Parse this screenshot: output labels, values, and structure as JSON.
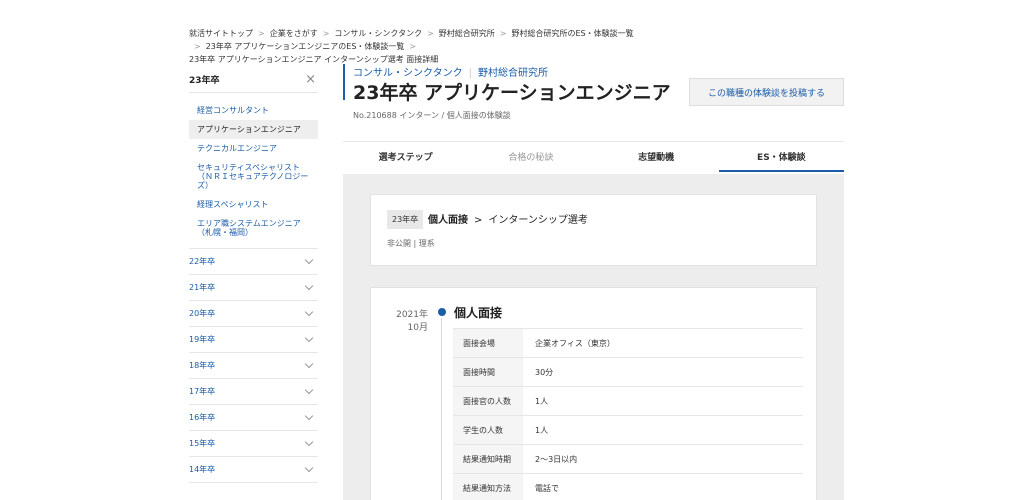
{
  "breadcrumb": [
    "就活サイトトップ",
    "企業をさがす",
    "コンサル・シンクタンク",
    "野村総合研究所",
    "野村総合研究所のES・体験談一覧",
    "23年卒 アプリケーションエンジニアのES・体験談一覧",
    "23年卒 アプリケーションエンジニア インターンシップ選考 面接詳細"
  ],
  "sidebar": {
    "current_year": "23年卒",
    "close_icon": "×",
    "jobs": [
      {
        "label": "経営コンサルタント"
      },
      {
        "label": "アプリケーションエンジニア"
      },
      {
        "label": "テクニカルエンジニア"
      },
      {
        "label": "セキュリティスペシャリスト（ＮＲＩセキュアテクノロジーズ）"
      },
      {
        "label": "経理スペシャリスト"
      },
      {
        "label": "エリア職システムエンジニア（札幌・福岡）"
      }
    ],
    "years": [
      "22年卒",
      "21年卒",
      "20年卒",
      "19年卒",
      "18年卒",
      "17年卒",
      "16年卒",
      "15年卒",
      "14年卒"
    ]
  },
  "header": {
    "category": "コンサル・シンクタンク",
    "company": "野村総合研究所",
    "title": "23年卒 アプリケーションエンジニア",
    "meta": "No.210688 インターン / 個人面接の体験談"
  },
  "post_button": "この職種の体験談を投稿する",
  "tabs": [
    {
      "label": "選考ステップ"
    },
    {
      "label": "合格の秘訣"
    },
    {
      "label": "志望動機"
    },
    {
      "label": "ES・体験談"
    }
  ],
  "summary": {
    "tag": "23年卒",
    "title": "個人面接",
    "arrow": ">",
    "subtitle": "インターンシップ選考",
    "meta": "非公開 | 理系"
  },
  "step": {
    "year": "2021年",
    "month": "10月",
    "title": "個人面接",
    "rows": [
      {
        "k": "面接会場",
        "v": "企業オフィス（東京）"
      },
      {
        "k": "面接時間",
        "v": "30分"
      },
      {
        "k": "面接官の人数",
        "v": "1人"
      },
      {
        "k": "学生の人数",
        "v": "1人"
      },
      {
        "k": "結果通知時期",
        "v": "2～3日以内"
      },
      {
        "k": "結果通知方法",
        "v": "電話で"
      }
    ]
  }
}
